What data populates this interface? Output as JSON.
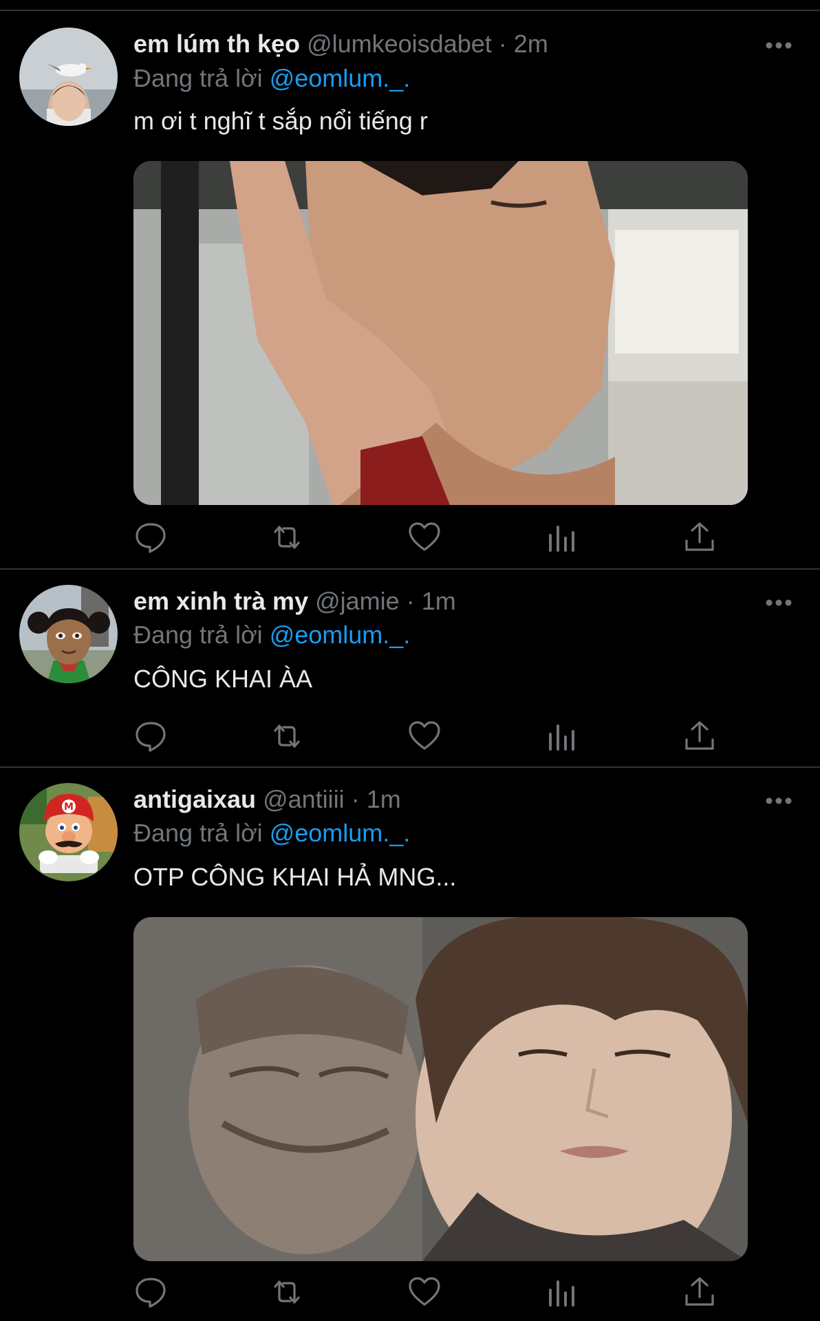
{
  "theme": {
    "background": "#000000",
    "divider": "#2f3336",
    "text_primary": "#e7e9ea",
    "text_secondary": "#71767b",
    "accent": "#1d9bf0"
  },
  "tweets": [
    {
      "display_name": "em lúm th kẹo",
      "handle": "@lumkeoisdabet",
      "separator": "·",
      "time": "2m",
      "reply_prefix": "Đang trả lời",
      "reply_mention": "@eomlum._.",
      "text": "m ơi t nghĩ t sắp nổi tiếng r",
      "avatar_icon": "seagull-on-head-photo",
      "has_media": true,
      "media_icon": "photo-man-ok-gesture-eyes-closed"
    },
    {
      "display_name": "em xinh trà my",
      "handle": "@jamie",
      "separator": "·",
      "time": "1m",
      "reply_prefix": "Đang trả lời",
      "reply_mention": "@eomlum._.",
      "text": "CÔNG KHAI ÀA",
      "avatar_icon": "cartoon-girl-pigtails",
      "has_media": false
    },
    {
      "display_name": "antigaixau",
      "handle": "@antiiii",
      "separator": "·",
      "time": "1m",
      "reply_prefix": "Đang trả lời",
      "reply_mention": "@eomlum._.",
      "text": "OTP CÔNG KHAI HẢ MNG...",
      "avatar_icon": "mario-typing",
      "has_media": true,
      "media_icon": "photo-two-faces-eyes-closed"
    }
  ],
  "actions": [
    "reply-icon",
    "retweet-icon",
    "like-icon",
    "analytics-icon",
    "share-icon"
  ]
}
